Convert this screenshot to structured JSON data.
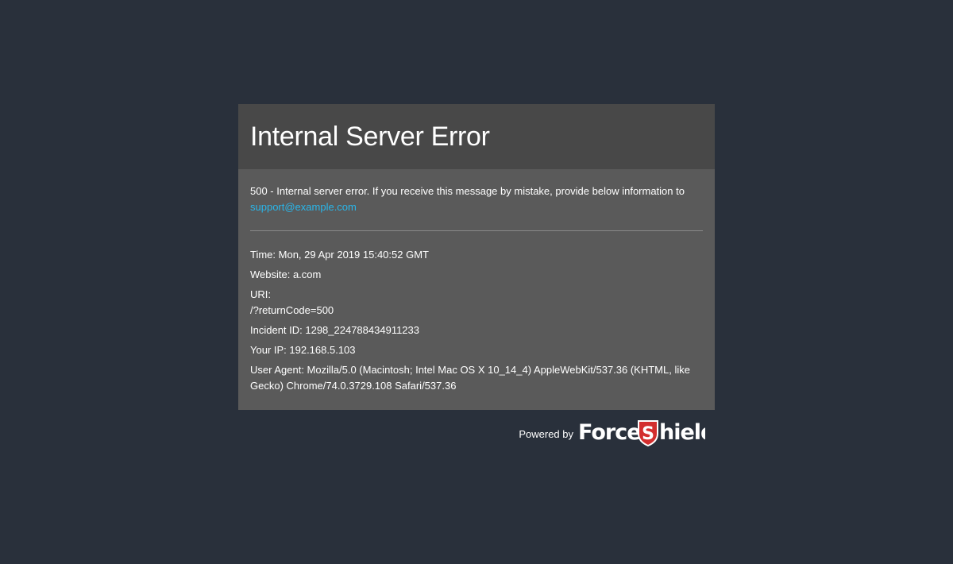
{
  "error": {
    "title": "Internal Server Error",
    "message": "500 - Internal server error. If you receive this message by mistake, provide below information to",
    "support_email": "support@example.com",
    "time": "Time: Mon, 29 Apr 2019 15:40:52 GMT",
    "website": "Website: a.com",
    "uri_label": "URI:",
    "uri_value": "/?returnCode=500",
    "incident": "Incident ID: 1298_224788434911233",
    "ip": "Your IP: 192.168.5.103",
    "user_agent": "User Agent: Mozilla/5.0 (Macintosh; Intel Mac OS X 10_14_4) AppleWebKit/537.36 (KHTML, like Gecko) Chrome/74.0.3729.108 Safari/537.36"
  },
  "footer": {
    "powered_by": "Powered by",
    "logo_text": "ForceShield"
  },
  "colors": {
    "background": "#29303b",
    "card_body": "#5a5a5a",
    "card_header": "#484848",
    "link": "#29b6ea",
    "logo_red": "#d32f2f"
  }
}
